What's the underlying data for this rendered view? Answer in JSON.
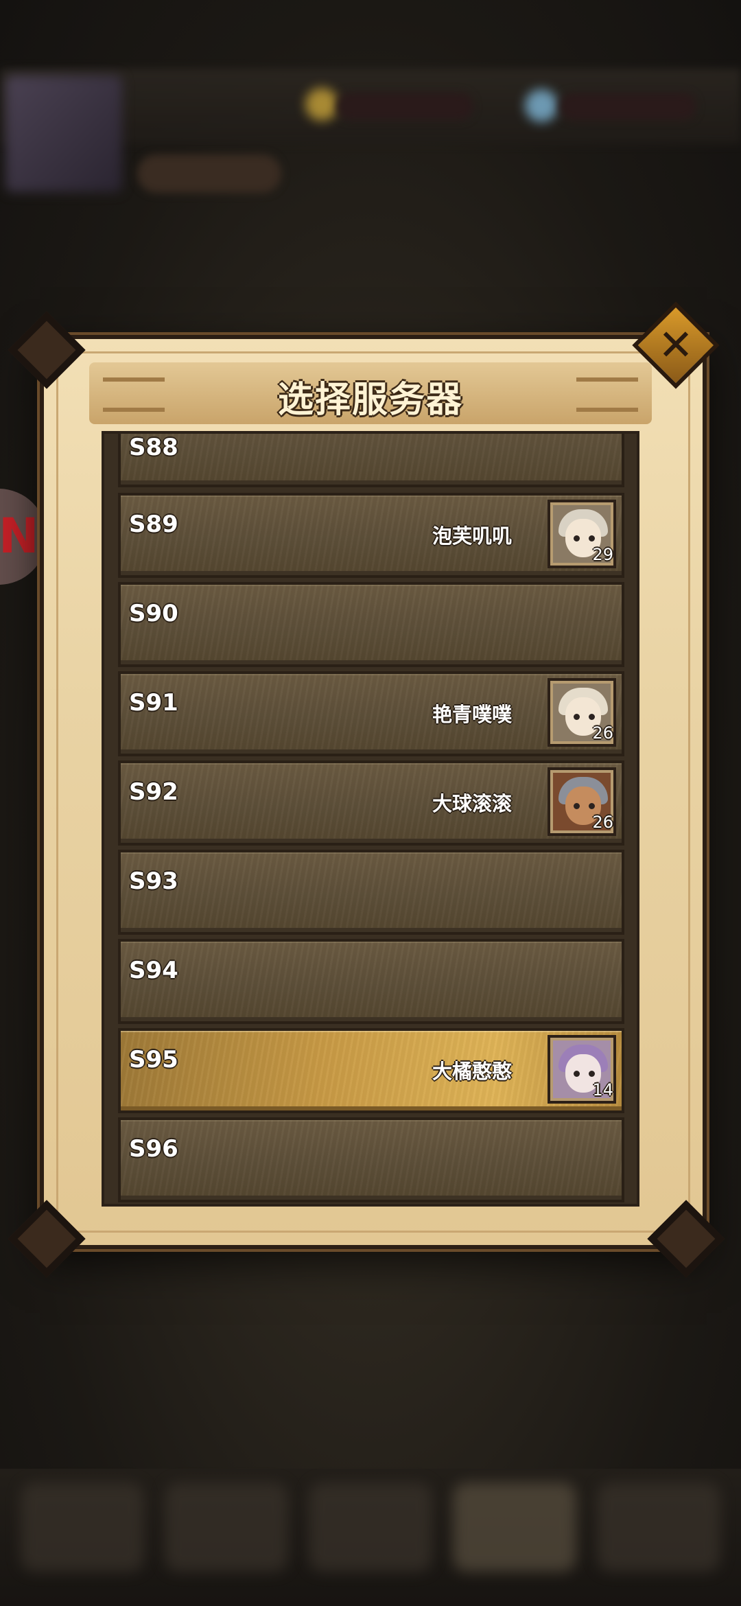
{
  "dialog": {
    "title": "选择服务器",
    "close_icon": "close-icon"
  },
  "servers": [
    {
      "id": "S88",
      "player": "",
      "level": "",
      "avatar": ""
    },
    {
      "id": "S89",
      "player": "泡芙叽叽",
      "level": "29",
      "avatar": "silver-haired-girl"
    },
    {
      "id": "S90",
      "player": "",
      "level": "",
      "avatar": ""
    },
    {
      "id": "S91",
      "player": "艳青噗噗",
      "level": "26",
      "avatar": "silver-haired-girl"
    },
    {
      "id": "S92",
      "player": "大球滚滚",
      "level": "26",
      "avatar": "armored-warrior"
    },
    {
      "id": "S93",
      "player": "",
      "level": "",
      "avatar": ""
    },
    {
      "id": "S94",
      "player": "",
      "level": "",
      "avatar": ""
    },
    {
      "id": "S95",
      "player": "大橘憨憨",
      "level": "14",
      "avatar": "purple-haired-girl",
      "selected": true
    },
    {
      "id": "S96",
      "player": "",
      "level": "",
      "avatar": ""
    }
  ],
  "colors": {
    "accent": "#d99a2a",
    "row": "#5d4f39",
    "selected_row": "#e0b457",
    "frame": "#e9d3a4"
  }
}
